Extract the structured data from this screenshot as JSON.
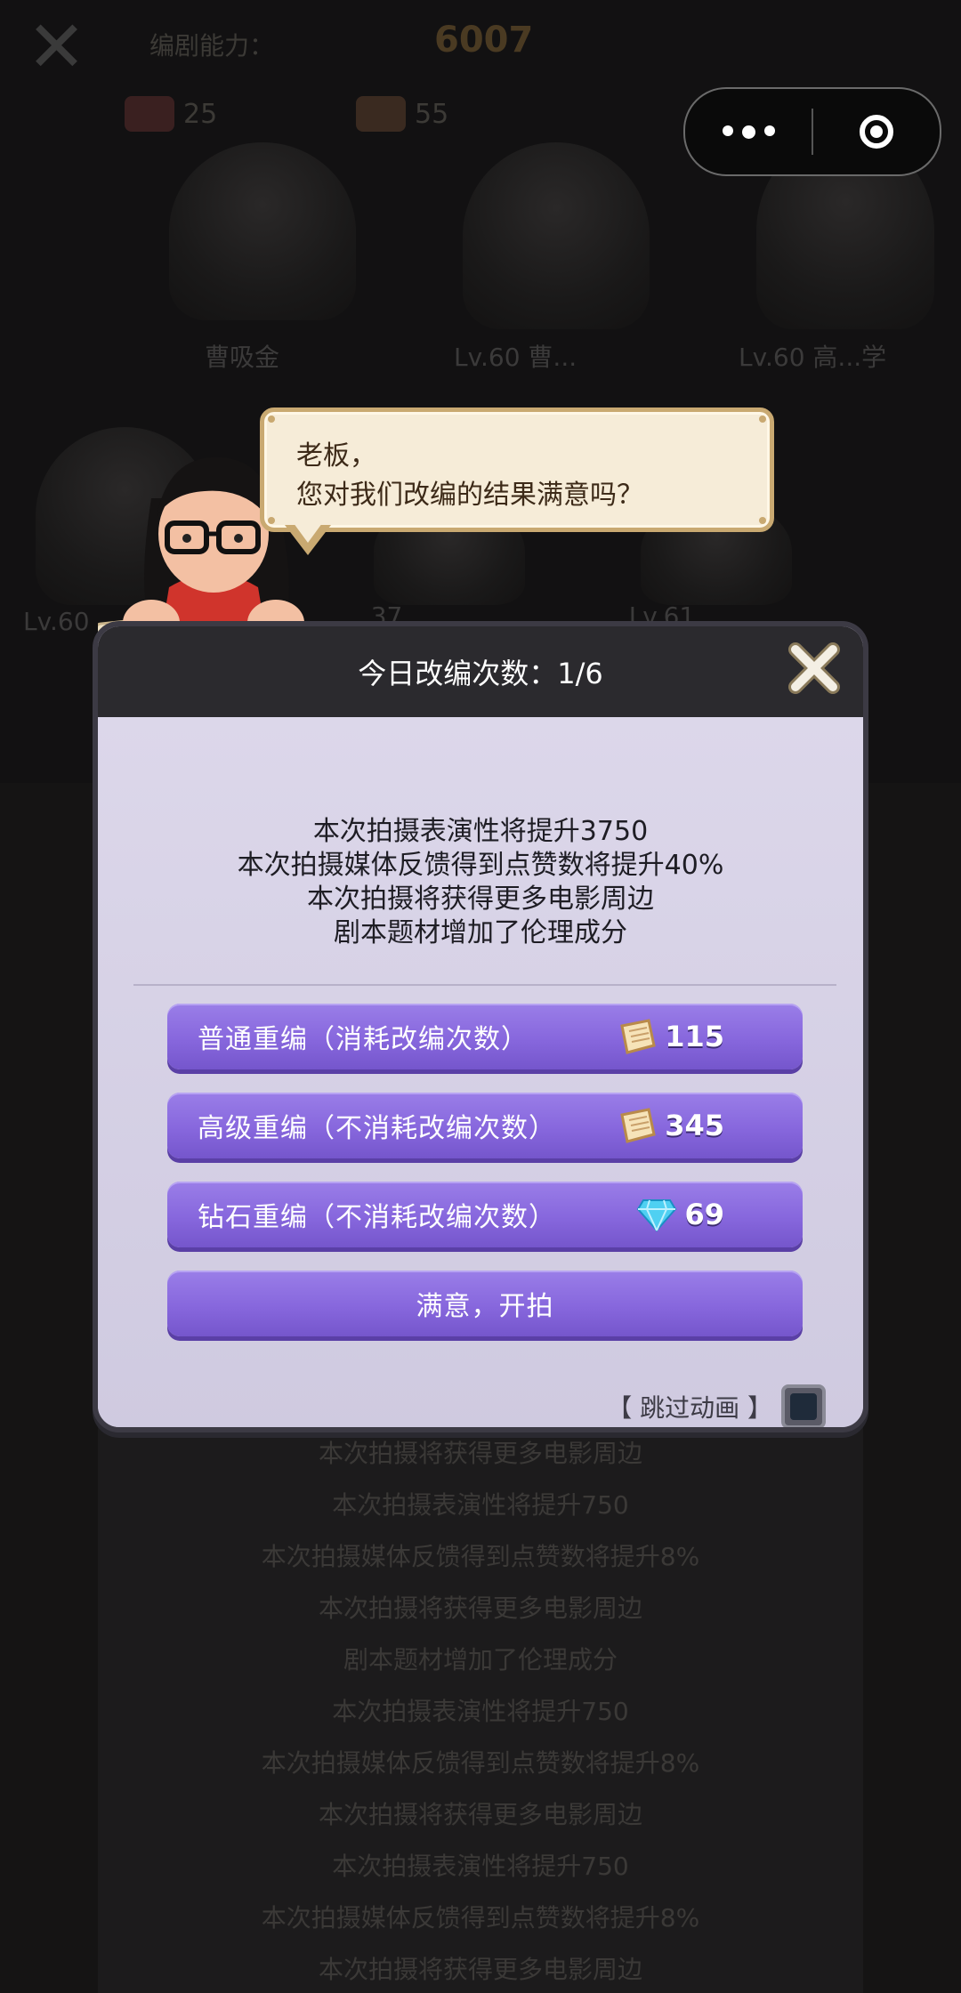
{
  "background": {
    "header_label": "编剧能力：",
    "header_value": "6007",
    "stat_1": "25",
    "stat_2": "55",
    "row1_levels": [
      "曹吸金",
      "Lv.60 曹...",
      "Lv.60 高...学"
    ],
    "row2_levels": [
      "Lv.60",
      "...37 ...",
      "...Lv.61 ..."
    ],
    "log_lines": [
      "本次拍摄将获得更多电影周边",
      "本次拍摄表演性将提升750",
      "本次拍摄媒体反馈得到点赞数将提升8%",
      "本次拍摄将获得更多电影周边",
      "剧本题材增加了伦理成分",
      "本次拍摄表演性将提升750",
      "本次拍摄媒体反馈得到点赞数将提升8%",
      "本次拍摄将获得更多电影周边",
      "本次拍摄表演性将提升750",
      "本次拍摄媒体反馈得到点赞数将提升8%",
      "本次拍摄将获得更多电影周边"
    ]
  },
  "bubble": {
    "line1": "老板，",
    "line2": "您对我们改编的结果满意吗？"
  },
  "dialog": {
    "title": "今日改编次数：1/6",
    "effects": [
      "本次拍摄表演性将提升3750",
      "本次拍摄媒体反馈得到点赞数将提升40%",
      "本次拍摄将获得更多电影周边",
      "剧本题材增加了伦理成分"
    ],
    "buttons": {
      "normal": {
        "label": "普通重编（消耗改编次数）",
        "cost": "115",
        "icon": "script-scroll-icon"
      },
      "advanced": {
        "label": "高级重编（不消耗改编次数）",
        "cost": "345",
        "icon": "script-scroll-icon"
      },
      "diamond": {
        "label": "钻石重编（不消耗改编次数）",
        "cost": "69",
        "icon": "diamond-icon"
      },
      "confirm": {
        "label": "满意，开拍"
      }
    },
    "skip_label": "【 跳过动画 】",
    "skip_checked": false
  },
  "colors": {
    "button_purple": "#8767dd",
    "dialog_bg": "#d6d1e6",
    "header_bg": "#2b2a2e"
  }
}
